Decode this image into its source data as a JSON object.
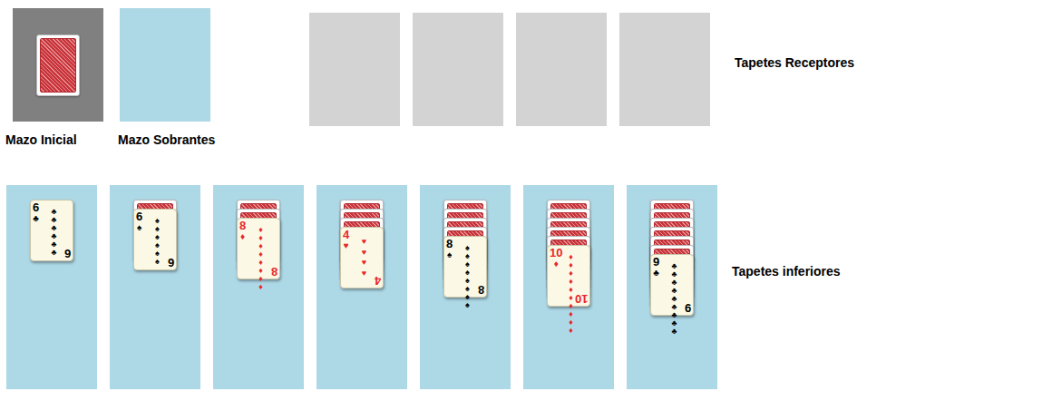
{
  "stock": {
    "label": "Mazo Inicial",
    "has_cards": true
  },
  "waste": {
    "label": "Mazo Sobrantes",
    "has_cards": false
  },
  "foundations": {
    "label": "Tapetes Receptores",
    "slots": [
      {
        "empty": true
      },
      {
        "empty": true
      },
      {
        "empty": true
      },
      {
        "empty": true
      }
    ]
  },
  "tableau": {
    "label": "Tapetes inferiores",
    "columns": [
      {
        "face_down": 0,
        "card": {
          "rank": "6",
          "suit": "♣",
          "pips": 6,
          "color": "#000000"
        }
      },
      {
        "face_down": 1,
        "card": {
          "rank": "6",
          "suit": "♠",
          "pips": 6,
          "color": "#000000"
        }
      },
      {
        "face_down": 2,
        "card": {
          "rank": "8",
          "suit": "♦",
          "pips": 8,
          "color": "#e8262b"
        }
      },
      {
        "face_down": 3,
        "card": {
          "rank": "4",
          "suit": "♥",
          "pips": 4,
          "color": "#e8262b"
        }
      },
      {
        "face_down": 4,
        "card": {
          "rank": "8",
          "suit": "♠",
          "pips": 8,
          "color": "#000000"
        }
      },
      {
        "face_down": 5,
        "card": {
          "rank": "10",
          "suit": "♦",
          "pips": 10,
          "color": "#e8262b"
        }
      },
      {
        "face_down": 6,
        "card": {
          "rank": "9",
          "suit": "♣",
          "pips": 9,
          "color": "#000000"
        }
      }
    ]
  }
}
